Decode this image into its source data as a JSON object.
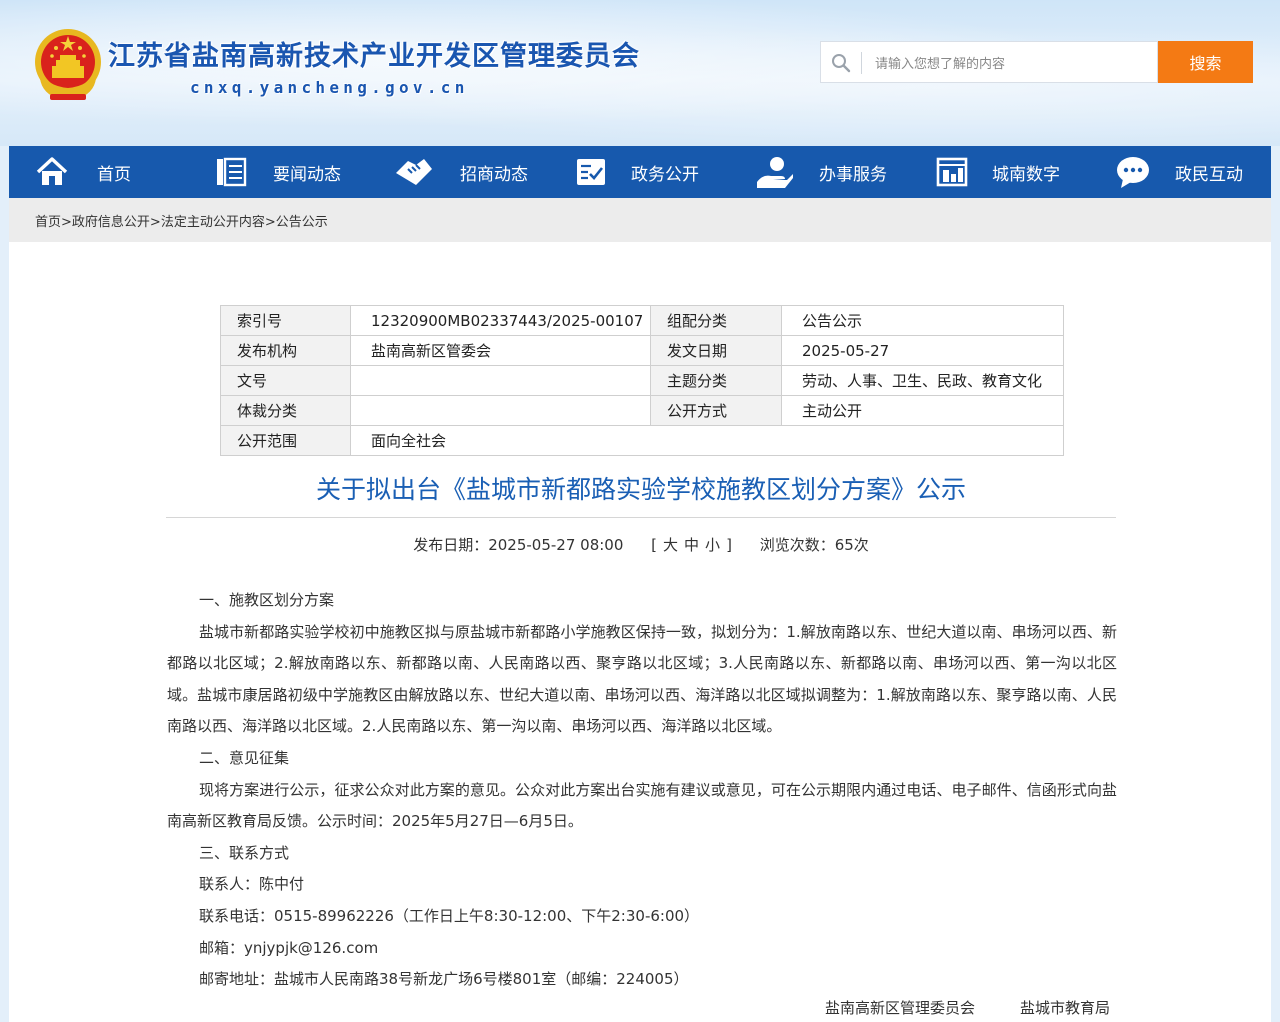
{
  "header": {
    "site_title": "江苏省盐南高新技术产业开发区管理委员会",
    "site_domain": "cnxq.yancheng.gov.cn",
    "search_placeholder": "请输入您想了解的内容",
    "search_button": "搜索",
    "accent_color": "#1759ad",
    "search_button_color": "#f47a14"
  },
  "nav": {
    "items": [
      {
        "label": "首页",
        "icon": "home-icon"
      },
      {
        "label": "要闻动态",
        "icon": "news-icon"
      },
      {
        "label": "招商动态",
        "icon": "handshake-icon"
      },
      {
        "label": "政务公开",
        "icon": "document-check-icon"
      },
      {
        "label": "办事服务",
        "icon": "service-hand-icon"
      },
      {
        "label": "城南数字",
        "icon": "digital-city-icon"
      },
      {
        "label": "政民互动",
        "icon": "chat-icon"
      }
    ]
  },
  "breadcrumb": {
    "items": [
      "首页>",
      "政府信息公开>",
      "法定主动公开内容>",
      "公告公示"
    ]
  },
  "meta_table": {
    "index_no_label": "索引号",
    "index_no": "12320900MB02337443/2025-00107",
    "category_label": "组配分类",
    "category": "公告公示",
    "issuer_label": "发布机构",
    "issuer": "盐南高新区管委会",
    "issue_date_label": "发文日期",
    "issue_date": "2025-05-27",
    "doc_no_label": "文号",
    "doc_no": "",
    "topic_label": "主题分类",
    "topic": "劳动、人事、卫生、民政、教育文化",
    "genre_label": "体裁分类",
    "genre": "",
    "open_mode_label": "公开方式",
    "open_mode": "主动公开",
    "scope_label": "公开范围",
    "scope": "面向全社会"
  },
  "article": {
    "title": "关于拟出台《盐城市新都路实验学校施教区划分方案》公示",
    "publish_label": "发布日期：2025-05-27 08:00",
    "font_size_open": "[",
    "font_large": "大",
    "font_medium": "中",
    "font_small": "小",
    "font_size_close": "]",
    "views_label": "浏览次数：65次",
    "paragraphs": [
      "一、施教区划分方案",
      "盐城市新都路实验学校初中施教区拟与原盐城市新都路小学施教区保持一致，拟划分为：1.解放南路以东、世纪大道以南、串场河以西、新都路以北区域；2.解放南路以东、新都路以南、人民南路以西、聚亨路以北区域；3.人民南路以东、新都路以南、串场河以西、第一沟以北区域。盐城市康居路初级中学施教区由解放路以东、世纪大道以南、串场河以西、海洋路以北区域拟调整为：1.解放南路以东、聚亨路以南、人民南路以西、海洋路以北区域。2.人民南路以东、第一沟以南、串场河以西、海洋路以北区域。",
      "二、意见征集",
      "现将方案进行公示，征求公众对此方案的意见。公众对此方案出台实施有建议或意见，可在公示期限内通过电话、电子邮件、信函形式向盐南高新区教育局反馈。公示时间：2025年5月27日—6月5日。",
      "三、联系方式",
      "联系人：陈中付",
      "联系电话：0515-89962226（工作日上午8:30-12:00、下午2:30-6:00）",
      "邮箱：ynjypjk@126.com",
      "邮寄地址：盐城市人民南路38号新龙广场6号楼801室（邮编：224005）"
    ],
    "signature_1": "盐南高新区管理委员会",
    "signature_2": "盐城市教育局"
  }
}
